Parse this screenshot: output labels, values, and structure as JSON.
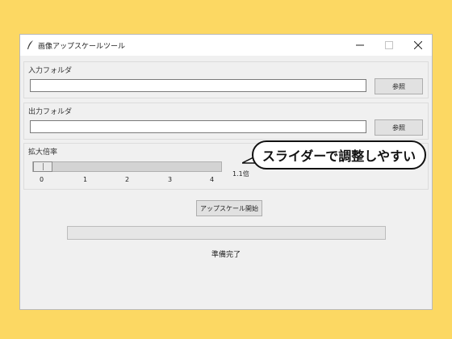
{
  "window": {
    "title": "画像アップスケールツール",
    "controls": [
      "minimize-icon",
      "maximize-icon",
      "close-icon"
    ]
  },
  "input_section": {
    "label": "入力フォルダ",
    "value": "",
    "browse_label": "参照"
  },
  "output_section": {
    "label": "出力フォルダ",
    "value": "",
    "browse_label": "参照"
  },
  "scale_section": {
    "label": "拡大倍率",
    "ticks": [
      "0",
      "1",
      "2",
      "3",
      "4"
    ],
    "value_text": "1.1倍",
    "slider_min": 0,
    "slider_max": 4,
    "slider_value": 0
  },
  "start_button": {
    "label": "アップスケール開始"
  },
  "progress": {
    "value": 0
  },
  "status": {
    "text": "準備完了"
  },
  "callout": {
    "text": "スライダーで調整しやすい"
  }
}
